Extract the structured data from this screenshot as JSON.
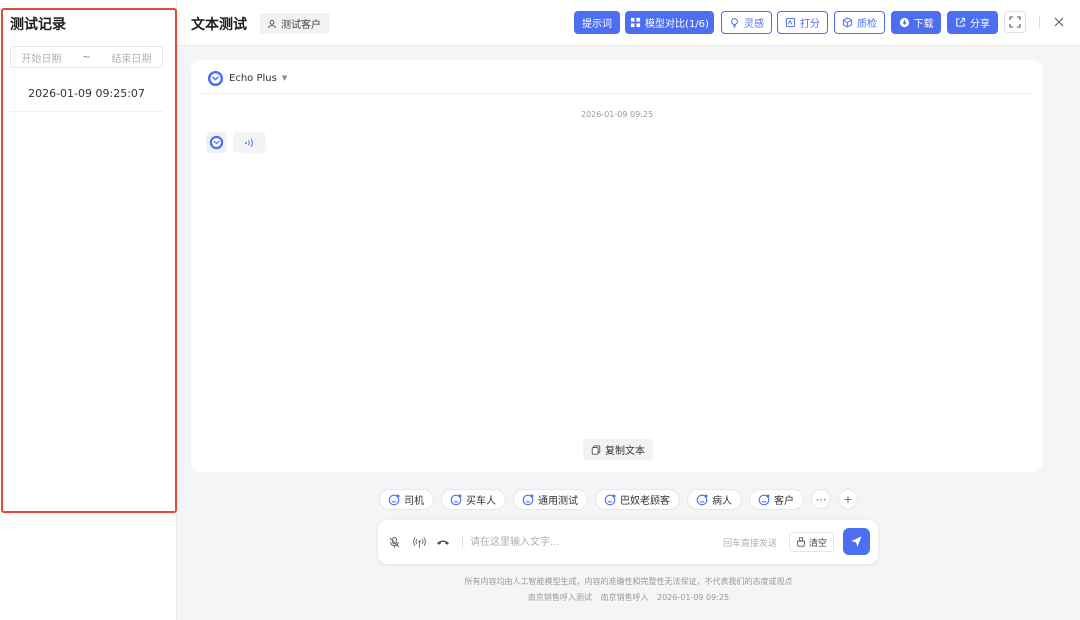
{
  "sidebar": {
    "title": "测试记录",
    "date_start_placeholder": "开始日期",
    "date_separator": "~",
    "date_end_placeholder": "结束日期",
    "records": [
      "2026-01-09 09:25:07"
    ]
  },
  "header": {
    "title": "文本测试",
    "customer_label": "测试客户",
    "buttons": {
      "prompt": "提示词",
      "model_compare": "模型对比(1/6)",
      "inspiration": "灵感",
      "score": "打分",
      "quality_check": "质检",
      "download": "下载",
      "share": "分享"
    }
  },
  "chat": {
    "model_name": "Echo Plus",
    "message_time": "2026-01-09 09:25",
    "audio_icon": "sound-wave-icon",
    "copy_text_label": "复制文本"
  },
  "roles": [
    "司机",
    "买车人",
    "通用测试",
    "巴奴老顾客",
    "病人",
    "客户"
  ],
  "input": {
    "placeholder": "请在这里输入文字...",
    "enter_hint": "回车直接发送",
    "clear_label": "清空"
  },
  "footer": {
    "disclaimer": "所有内容均由人工智能模型生成，内容的准确性和完整性无法保证，不代表我们的态度或观点",
    "company": "南京销售呼入测试",
    "company2": "南京销售呼入",
    "timestamp": "2026-01-09 09:25"
  },
  "colors": {
    "accent": "#4e6ef2",
    "highlight_border": "#e44a3a"
  }
}
